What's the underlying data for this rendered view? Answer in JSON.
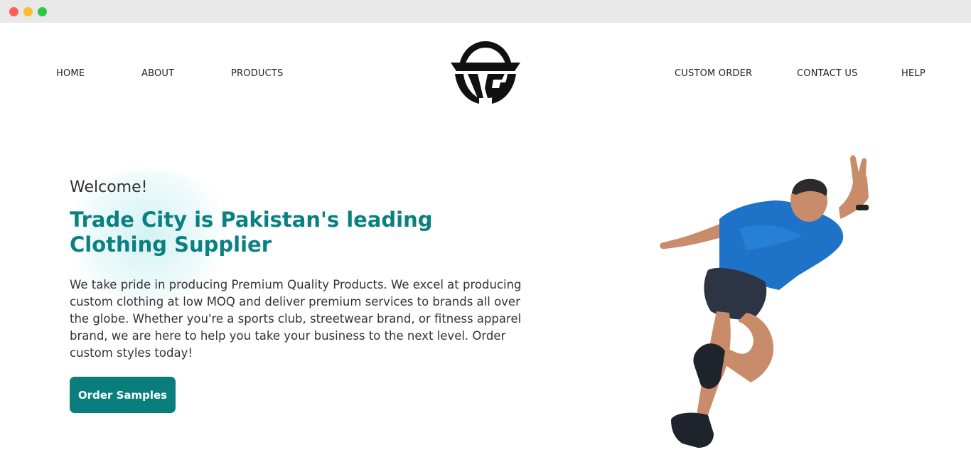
{
  "nav": {
    "left": [
      {
        "label": "HOME"
      },
      {
        "label": "ABOUT"
      },
      {
        "label": "PRODUCTS"
      }
    ],
    "right": [
      {
        "label": "CUSTOM ORDER"
      },
      {
        "label": "CONTACT US"
      },
      {
        "label": "HELP"
      }
    ]
  },
  "hero": {
    "welcome": "Welcome!",
    "headline": "Trade City is Pakistan's leading Clothing Supplier",
    "description": "We take pride in producing Premium Quality Products. We excel at producing custom clothing at low MOQ and deliver premium services to brands all over the globe. Whether you're a sports club, streetwear brand, or fitness apparel brand, we are here to help you take your business to the next level. Order custom styles today!",
    "cta_label": "Order Samples"
  },
  "colors": {
    "accent": "#0a7d7d",
    "headline": "#0a8080"
  },
  "icons": {
    "logo": "trade-city-logo-icon",
    "hero_image": "runner-athlete-image"
  }
}
